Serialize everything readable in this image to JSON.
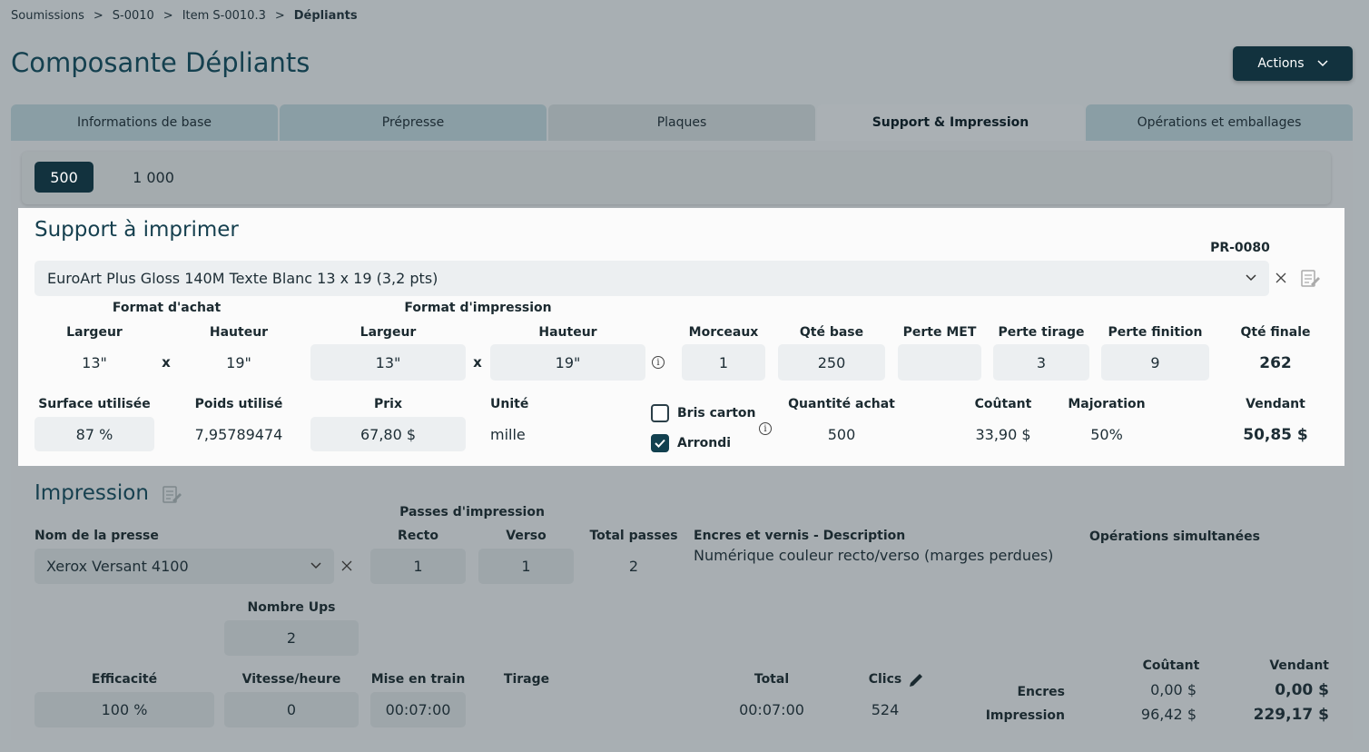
{
  "breadcrumb": [
    "Soumissions",
    ">",
    "S-0010",
    ">",
    "Item S-0010.3",
    ">",
    "Dépliants"
  ],
  "page_title": "Composante Dépliants",
  "actions_label": "Actions",
  "tabs": [
    "Informations de base",
    "Prépresse",
    "Plaques",
    "Support & Impression",
    "Opérations et emballages"
  ],
  "quantities": [
    "500",
    "1 000"
  ],
  "support": {
    "title": "Support à imprimer",
    "code": "PR-0080",
    "selected": "EuroArt Plus Gloss 140M Texte Blanc 13 x 19 (3,2 pts)",
    "format_achat": "Format d'achat",
    "format_impression": "Format d'impression",
    "largeur": "Largeur",
    "hauteur": "Hauteur",
    "x": "x",
    "achat_largeur": "13\"",
    "achat_hauteur": "19\"",
    "imp_largeur": "13\"",
    "imp_hauteur": "19\"",
    "morceaux_lbl": "Morceaux",
    "morceaux": "1",
    "qte_base_lbl": "Qté base",
    "qte_base": "250",
    "perte_met_lbl": "Perte MET",
    "perte_met": "",
    "perte_tirage_lbl": "Perte tirage",
    "perte_tirage": "3",
    "perte_finition_lbl": "Perte finition",
    "perte_finition": "9",
    "qte_finale_lbl": "Qté finale",
    "qte_finale": "262",
    "surface_lbl": "Surface utilisée",
    "surface": "87 %",
    "poids_lbl": "Poids utilisé",
    "poids": "7,95789474",
    "prix_lbl": "Prix",
    "prix": "67,80 $",
    "unite_lbl": "Unité",
    "unite": "mille",
    "bris_carton": "Bris carton",
    "arrondi": "Arrondi",
    "qte_achat_lbl": "Quantité achat",
    "qte_achat": "500",
    "coutant_lbl": "Coûtant",
    "coutant": "33,90 $",
    "majoration_lbl": "Majoration",
    "majoration": "50%",
    "vendant_lbl": "Vendant",
    "vendant": "50,85 $"
  },
  "impression": {
    "title": "Impression",
    "presse_lbl": "Nom de la presse",
    "presse": "Xerox Versant 4100",
    "passes_lbl": "Passes d'impression",
    "recto_lbl": "Recto",
    "recto": "1",
    "verso_lbl": "Verso",
    "verso": "1",
    "total_passes_lbl": "Total passes",
    "total_passes": "2",
    "encres_lbl": "Encres et vernis - Description",
    "encres": "Numérique couleur recto/verso (marges perdues)",
    "ops_sim_lbl": "Opérations simultanées",
    "ups_lbl": "Nombre Ups",
    "ups": "2",
    "efficacite_lbl": "Efficacité",
    "efficacite": "100 %",
    "vitesse_lbl": "Vitesse/heure",
    "vitesse": "0",
    "mise_lbl": "Mise en train",
    "mise": "00:07:00",
    "tirage_lbl": "Tirage",
    "total_lbl": "Total",
    "total": "00:07:00",
    "clics_lbl": "Clics",
    "clics": "524",
    "coutant_lbl": "Coûtant",
    "vendant_lbl": "Vendant",
    "encres_row": "Encres",
    "encres_coutant": "0,00 $",
    "encres_vendant": "0,00 $",
    "impression_row": "Impression",
    "impression_coutant": "96,42 $",
    "impression_vendant": "229,17 $"
  }
}
